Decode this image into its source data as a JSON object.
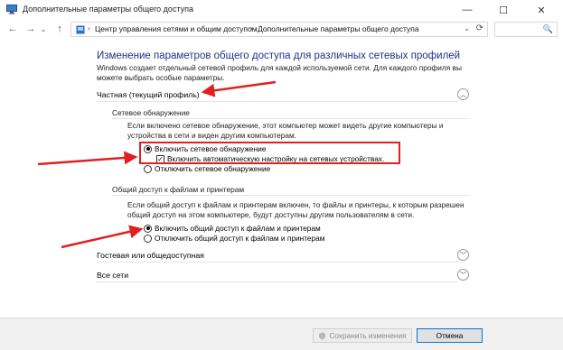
{
  "window": {
    "title": "Дополнительные параметры общего доступа",
    "min_glyph": "—",
    "max_glyph": "☐",
    "close_glyph": "✕"
  },
  "nav": {
    "back_glyph": "←",
    "forward_glyph": "→",
    "history_glyph": "⌄",
    "up_glyph": "↑",
    "breadcrumb": [
      "Центр управления сетями и общим доступом",
      "Дополнительные параметры общего доступа"
    ],
    "separator": "›",
    "dropdown_glyph": "⌄",
    "refresh_glyph": "⟳",
    "search_placeholder": "",
    "search_glyph": "🔍"
  },
  "main": {
    "heading": "Изменение параметров общего доступа для различных сетевых профилей",
    "intro": "Windows создает отдельный сетевой профиль для каждой используемой сети. Для каждого профиля вы можете выбрать особые параметры.",
    "profiles": [
      {
        "label": "Частная (текущий профиль)",
        "expanded": true,
        "chevron": "︿"
      },
      {
        "label": "Гостевая или общедоступная",
        "expanded": false,
        "chevron": "﹀"
      },
      {
        "label": "Все сети",
        "expanded": false,
        "chevron": "﹀"
      }
    ],
    "discovery": {
      "title": "Сетевое обнаружение",
      "description": "Если включено сетевое обнаружение, этот компьютер может видеть другие компьютеры и устройства в сети и виден другим компьютерам.",
      "option_on": "Включить сетевое обнаружение",
      "auto_setup": "Включить автоматическую настройку на сетевых устройствах.",
      "auto_setup_checked": true,
      "option_off": "Отключить сетевое обнаружение",
      "selected": "on"
    },
    "sharing": {
      "title": "Общий доступ к файлам и принтерам",
      "description": "Если общий доступ к файлам и принтерам включен, то файлы и принтеры, к которым разрешен общий доступ на этом компьютере, будут доступны другим пользователям в сети.",
      "option_on": "Включить общий доступ к файлам и принтерам",
      "option_off": "Отключить общий доступ к файлам и принтерам",
      "selected": "on"
    }
  },
  "footer": {
    "save_label": "Сохранить изменения",
    "cancel_label": "Отмена"
  },
  "colors": {
    "heading": "#1e3287",
    "annotation_red": "#e02020",
    "focus_blue": "#0078d7"
  }
}
